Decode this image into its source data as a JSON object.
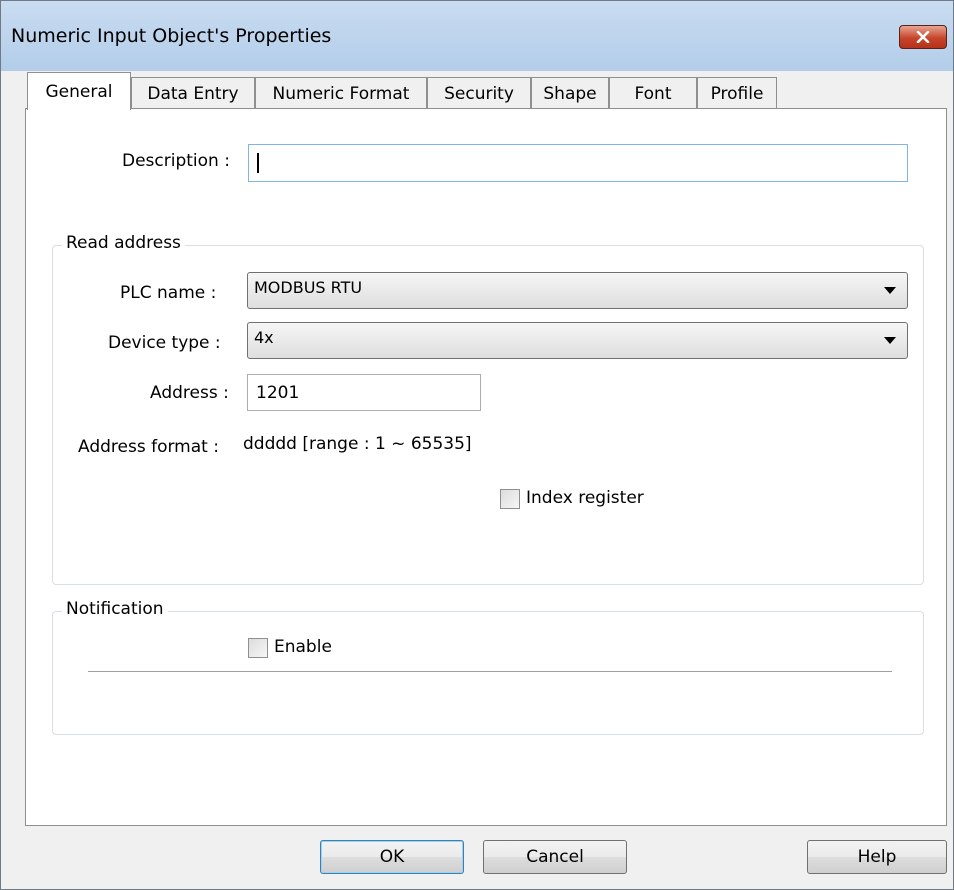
{
  "window": {
    "title": "Numeric Input Object's Properties"
  },
  "tabs": [
    {
      "label": "General"
    },
    {
      "label": "Data Entry"
    },
    {
      "label": "Numeric Format"
    },
    {
      "label": "Security"
    },
    {
      "label": "Shape"
    },
    {
      "label": "Font"
    },
    {
      "label": "Profile"
    }
  ],
  "general": {
    "description_label": "Description :",
    "description_value": "",
    "read_address": {
      "legend": "Read address",
      "plc_name_label": "PLC name :",
      "plc_name_value": "MODBUS RTU",
      "device_type_label": "Device type :",
      "device_type_value": "4x",
      "address_label": "Address :",
      "address_value": "1201",
      "address_format_label": "Address format :",
      "address_format_value": "ddddd [range : 1 ~ 65535]",
      "index_register_label": "Index register",
      "index_register_checked": false
    },
    "notification": {
      "legend": "Notification",
      "enable_label": "Enable",
      "enable_checked": false
    }
  },
  "buttons": {
    "ok": "OK",
    "cancel": "Cancel",
    "help": "Help"
  },
  "icons": {
    "close": "close-icon",
    "dropdown": "chevron-down-icon"
  },
  "colors": {
    "title_bar": "#b9d1ea",
    "close_button": "#c7452c",
    "focus_border": "#7eb4ea"
  }
}
